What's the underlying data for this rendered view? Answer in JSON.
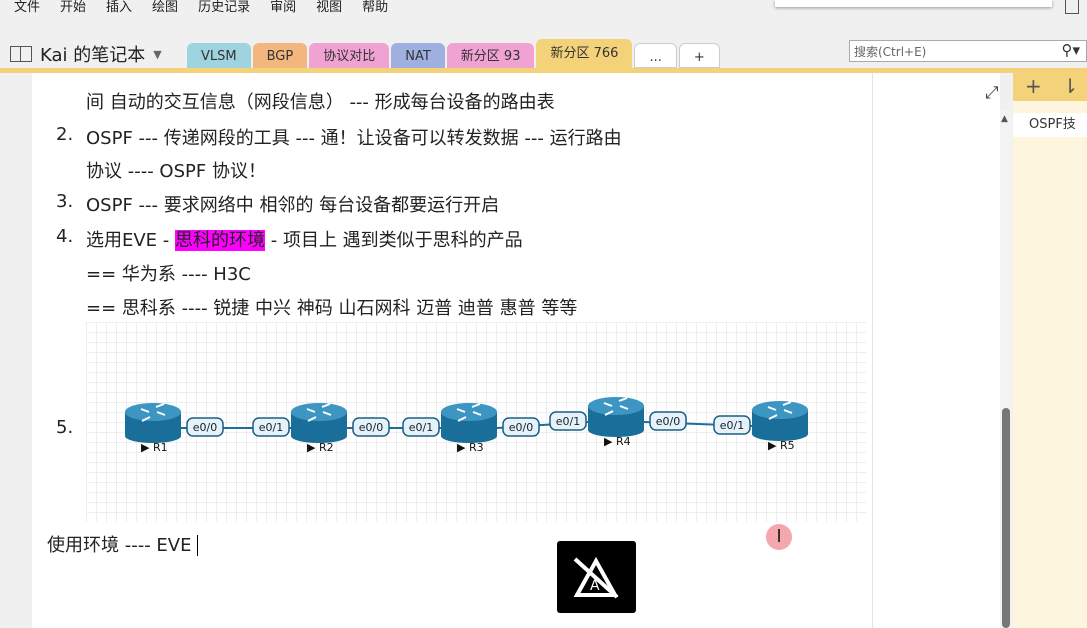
{
  "menu": [
    "文件",
    "开始",
    "插入",
    "绘图",
    "历史记录",
    "审阅",
    "视图",
    "帮助"
  ],
  "notebook": {
    "title": "Kai 的笔记本"
  },
  "tabs": [
    {
      "label": "VLSM",
      "color": "#9fd3df"
    },
    {
      "label": "BGP",
      "color": "#f2b67e"
    },
    {
      "label": "协议对比",
      "color": "#f0a3d3"
    },
    {
      "label": "NAT",
      "color": "#9fb0e0"
    },
    {
      "label": "新分区 93",
      "color": "#f0a3d3"
    },
    {
      "label": "新分区 766",
      "color": "#f3d27a"
    },
    {
      "label": "...",
      "color": "#ffffff"
    },
    {
      "label": "+",
      "color": "#ffffff"
    }
  ],
  "search": {
    "placeholder": "搜索(Ctrl+E)"
  },
  "pages": {
    "add": "+",
    "sort": "⇂",
    "items": [
      "OSPF技"
    ]
  },
  "note": {
    "l0": "间 自动的交互信息（网段信息） --- 形成每台设备的路由表",
    "n2": "2.",
    "l2a": "OSPF --- 传递网段的工具 --- 通！让设备可以转发数据 --- 运行路由",
    "l2b": "协议 ---- OSPF 协议！",
    "n3": "3.",
    "l3": "OSPF --- 要求网络中 相邻的 每台设备都要运行开启",
    "n4": "4.",
    "l4a": "选用EVE - ",
    "l4hl": "思科的环境",
    "l4b": " - 项目上 遇到类似于思科的产品",
    "l4c": "== 华为系 ---- H3C",
    "l4d": "== 思科系 ---- 锐捷 中兴 神码 山石网科 迈普 迪普 惠普 等等",
    "n5": "5.",
    "footer": "使用环境 ---- EVE"
  },
  "topology": {
    "routers": [
      "R1",
      "R2",
      "R3",
      "R4",
      "R5"
    ],
    "links": [
      [
        "e0/0",
        "e0/1"
      ],
      [
        "e0/0",
        "e0/1"
      ],
      [
        "e0/0",
        "e0/1"
      ],
      [
        "e0/0",
        "e0/1"
      ]
    ]
  }
}
